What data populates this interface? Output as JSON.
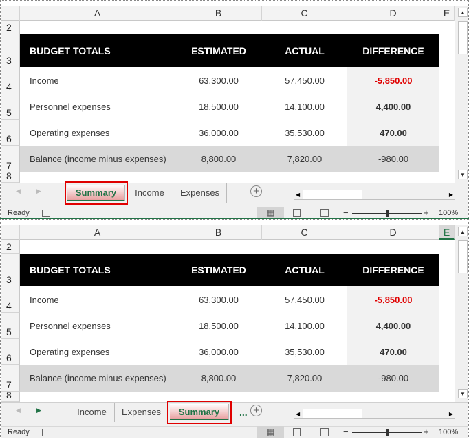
{
  "columns": [
    "A",
    "B",
    "C",
    "D",
    "E"
  ],
  "rows": [
    "2",
    "3",
    "4",
    "5",
    "6",
    "7",
    "8"
  ],
  "table": {
    "headers": [
      "BUDGET TOTALS",
      "ESTIMATED",
      "ACTUAL",
      "DIFFERENCE"
    ],
    "rows": [
      [
        "Income",
        "63,300.00",
        "57,450.00",
        "-5,850.00"
      ],
      [
        "Personnel expenses",
        "18,500.00",
        "14,100.00",
        "4,400.00"
      ],
      [
        "Operating expenses",
        "36,000.00",
        "35,530.00",
        "470.00"
      ],
      [
        "Balance (income minus expenses)",
        "8,800.00",
        "7,820.00",
        "-980.00"
      ]
    ]
  },
  "colors": {
    "negative": "#e00000",
    "header_bg": "#000000",
    "accent": "#217346",
    "highlight": "#e00000"
  },
  "windows": [
    {
      "tabs": [
        "Summary",
        "Income",
        "Expenses"
      ],
      "active_tab": "Summary"
    },
    {
      "tabs": [
        "Income",
        "Expenses",
        "Summary"
      ],
      "active_tab": "Summary",
      "overflow": "..."
    }
  ],
  "status": {
    "ready": "Ready",
    "zoom": "100%",
    "zoom_level_percent": 100
  }
}
